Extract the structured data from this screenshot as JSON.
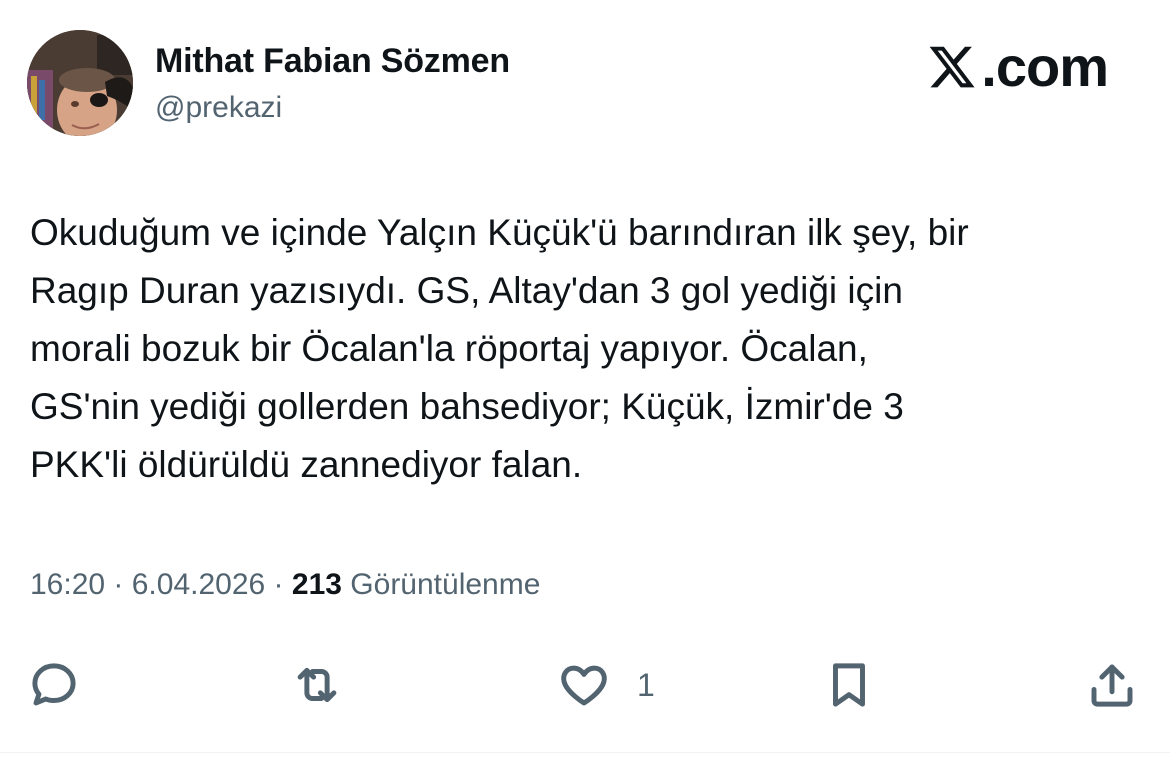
{
  "author": {
    "name": "Mithat Fabian Sözmen",
    "handle": "@prekazi"
  },
  "brand": {
    "label": ".com"
  },
  "tweet": {
    "text": "Okuduğum ve içinde Yalçın Küçük'ü barındıran ilk şey, bir\nRagıp Duran yazısıydı. GS, Altay'dan 3 gol yediği için\nmorali bozuk bir Öcalan'la röportaj yapıyor. Öcalan,\nGS'nin yediği gollerden bahsediyor; Küçük, İzmir'de 3\nPKK'li öldürüldü zannediyor falan."
  },
  "meta": {
    "time": "16:20",
    "separator": " · ",
    "date": "6.04.2026",
    "views_count": "213",
    "views_label": "Görüntülenme"
  },
  "actions": {
    "reply_icon": "reply-icon",
    "retweet_icon": "retweet-icon",
    "like_icon": "heart-icon",
    "like_count": "1",
    "bookmark_icon": "bookmark-icon",
    "share_icon": "share-icon"
  },
  "colors": {
    "text": "#0f1419",
    "secondary": "#536471",
    "divider": "#eff3f4"
  }
}
